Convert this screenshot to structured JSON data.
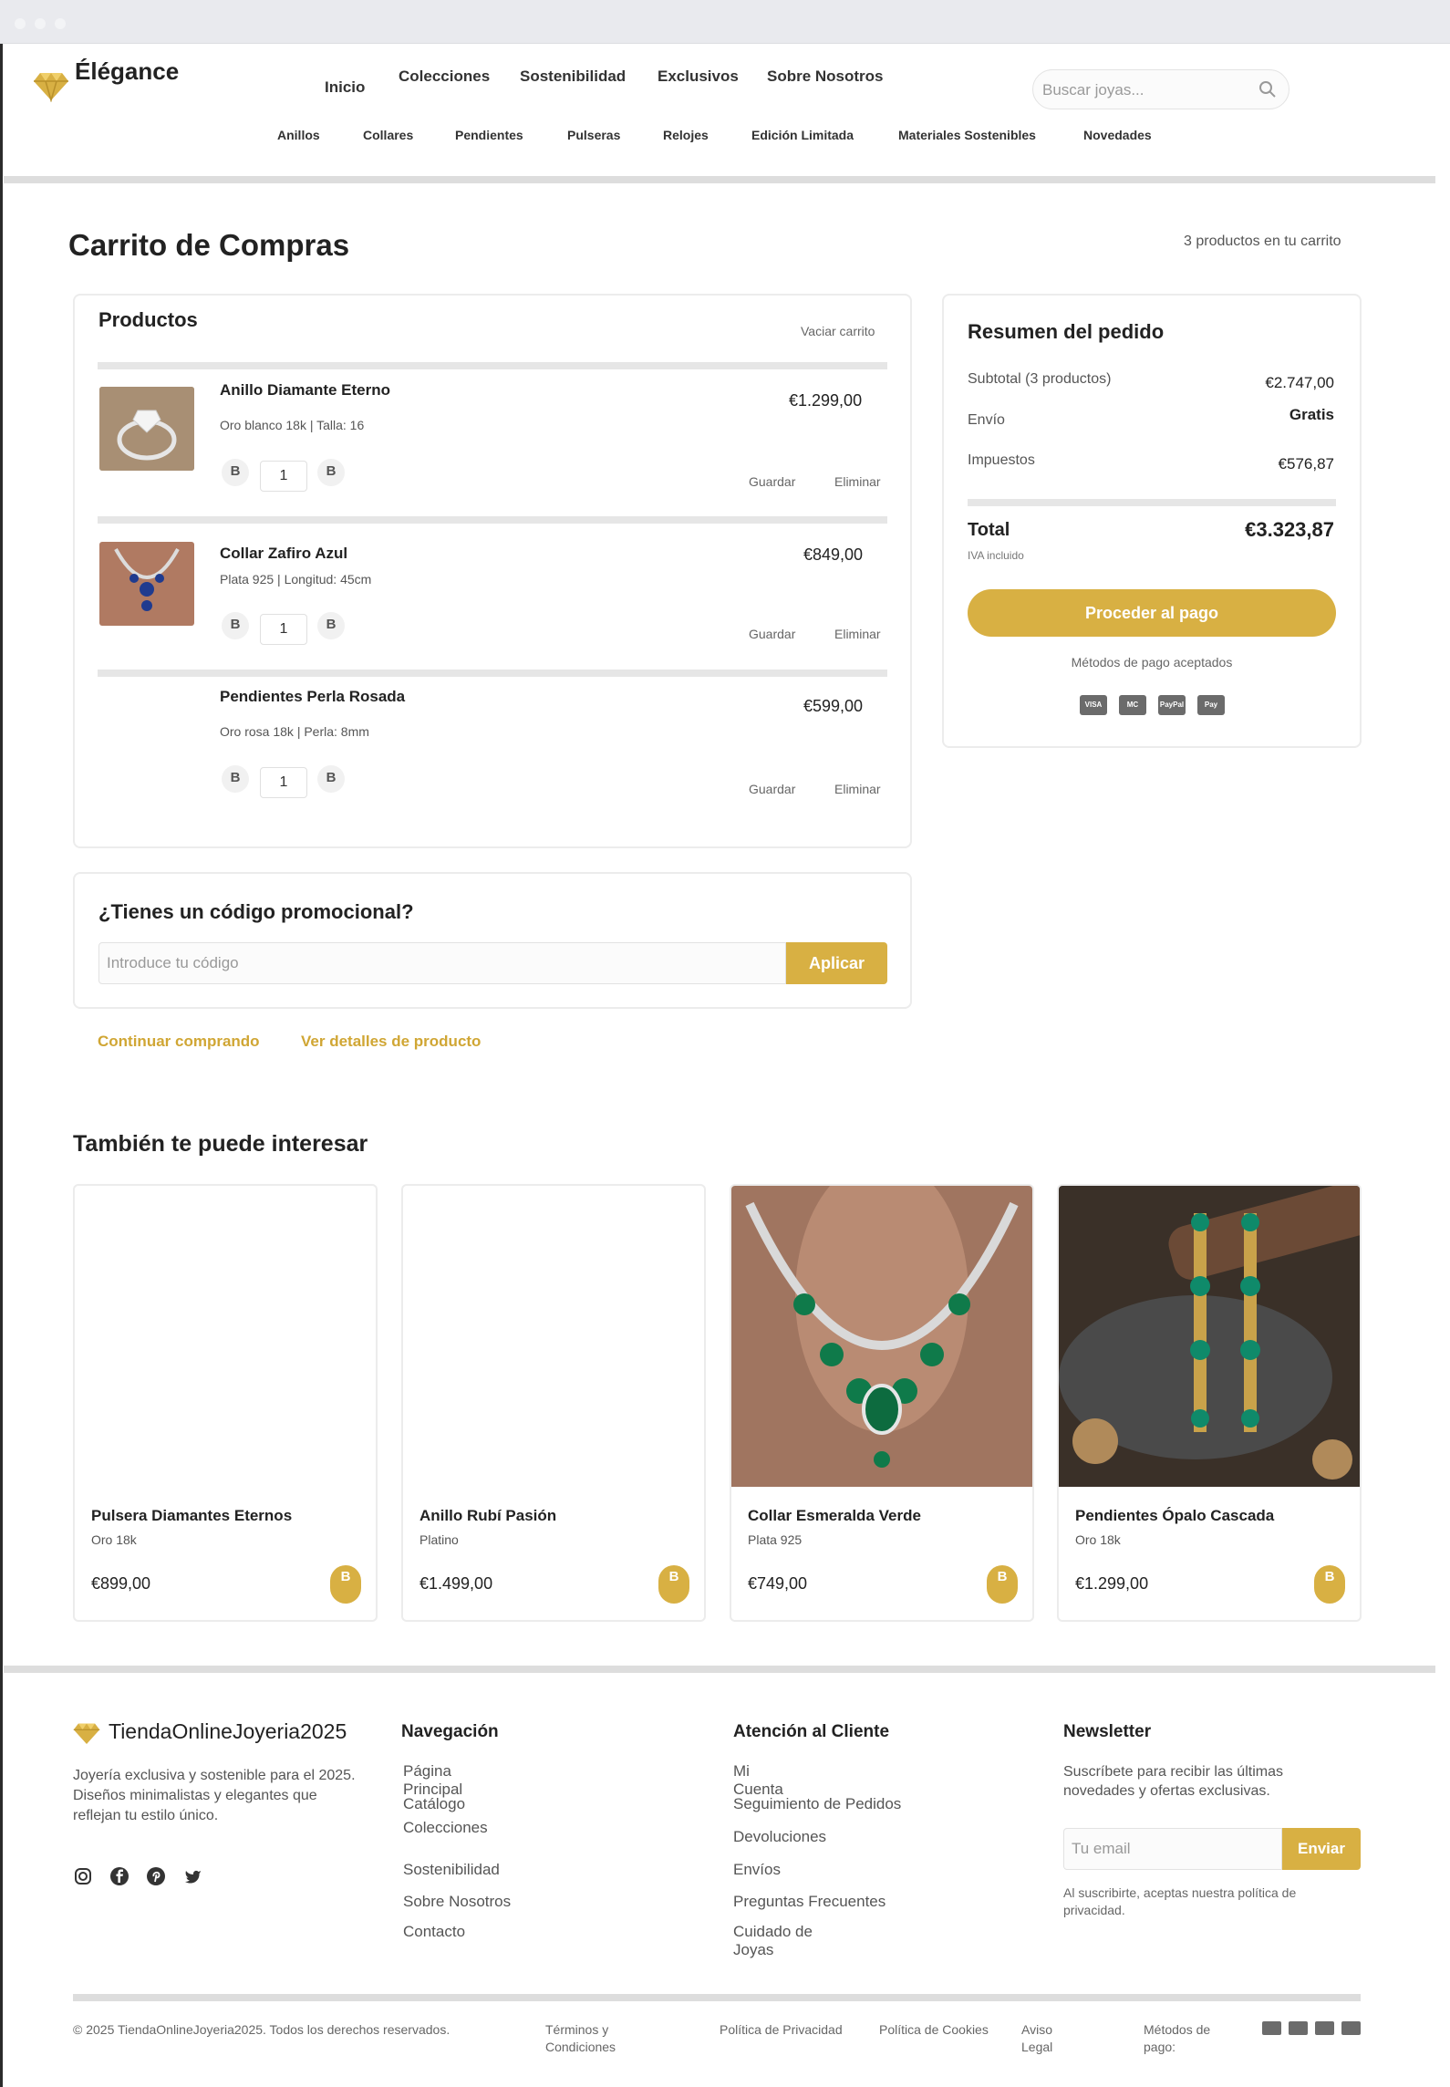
{
  "header": {
    "logo_text": "Élégance",
    "nav_main": [
      "Inicio",
      "Colecciones",
      "Sostenibilidad",
      "Exclusivos",
      "Sobre Nosotros"
    ],
    "nav_sub": [
      "Anillos",
      "Collares",
      "Pendientes",
      "Pulseras",
      "Relojes",
      "Edición Limitada",
      "Materiales Sostenibles",
      "Novedades"
    ],
    "search_placeholder": "Buscar joyas..."
  },
  "cart": {
    "title": "Carrito de Compras",
    "count_text": "3 productos en tu carrito",
    "products_heading": "Productos",
    "empty_cart": "Vaciar carrito",
    "items": [
      {
        "name": "Anillo Diamante Eterno",
        "spec": "Oro blanco 18k | Talla: 16",
        "price": "€1.299,00",
        "qty": "1",
        "minus": "B",
        "plus": "B",
        "save": "Guardar",
        "remove": "Eliminar"
      },
      {
        "name": "Collar Zafiro Azul",
        "spec": "Plata 925 | Longitud: 45cm",
        "price": "€849,00",
        "qty": "1",
        "minus": "B",
        "plus": "B",
        "save": "Guardar",
        "remove": "Eliminar"
      },
      {
        "name": "Pendientes Perla Rosada",
        "spec": "Oro rosa 18k | Perla: 8mm",
        "price": "€599,00",
        "qty": "1",
        "minus": "B",
        "plus": "B",
        "save": "Guardar",
        "remove": "Eliminar"
      }
    ]
  },
  "summary": {
    "title": "Resumen del pedido",
    "subtotal_label": "Subtotal (3 productos)",
    "subtotal": "€2.747,00",
    "shipping_label": "Envío",
    "shipping": "Gratis",
    "tax_label": "Impuestos",
    "tax": "€576,87",
    "total_label": "Total",
    "total": "€3.323,87",
    "vat_note": "IVA incluido",
    "checkout": "Proceder al pago",
    "methods_label": "Métodos de pago aceptados",
    "methods": [
      "VISA",
      "MC",
      "PayPal",
      "Pay"
    ]
  },
  "promo": {
    "title": "¿Tienes un código promocional?",
    "placeholder": "Introduce tu código",
    "apply": "Aplicar"
  },
  "links": {
    "continue": "Continuar comprando",
    "details": "Ver detalles de producto"
  },
  "recommendations": {
    "title": "También te puede interesar",
    "items": [
      {
        "name": "Pulsera Diamantes Eternos",
        "material": "Oro 18k",
        "price": "€899,00",
        "add": "B"
      },
      {
        "name": "Anillo Rubí Pasión",
        "material": "Platino",
        "price": "€1.499,00",
        "add": "B"
      },
      {
        "name": "Collar Esmeralda Verde",
        "material": "Plata 925",
        "price": "€749,00",
        "add": "B"
      },
      {
        "name": "Pendientes Ópalo Cascada",
        "material": "Oro 18k",
        "price": "€1.299,00",
        "add": "B"
      }
    ]
  },
  "footer": {
    "brand": "TiendaOnlineJoyeria2025",
    "description": "Joyería exclusiva y sostenible para el 2025. Diseños minimalistas y elegantes que reflejan tu estilo único.",
    "nav_title": "Navegación",
    "nav_links": [
      "Página Principal",
      "Catálogo",
      "Colecciones",
      "Sostenibilidad",
      "Sobre Nosotros",
      "Contacto"
    ],
    "service_title": "Atención al Cliente",
    "service_links": [
      "Mi Cuenta",
      "Seguimiento de Pedidos",
      "Devoluciones",
      "Envíos",
      "Preguntas Frecuentes",
      "Cuidado de Joyas"
    ],
    "newsletter_title": "Newsletter",
    "newsletter_text": "Suscríbete para recibir las últimas novedades y ofertas exclusivas.",
    "email_placeholder": "Tu email",
    "send": "Enviar",
    "privacy_note": "Al suscribirte, aceptas nuestra política de privacidad.",
    "copyright": "© 2025 TiendaOnlineJoyeria2025. Todos los derechos reservados.",
    "terms": "Términos y Condiciones",
    "privacy": "Política de Privacidad",
    "cookies": "Política de Cookies",
    "legal": "Aviso Legal",
    "payment_methods": "Métodos de pago:"
  },
  "colors": {
    "accent": "#d8b043",
    "text": "#222222",
    "muted": "#555555"
  }
}
